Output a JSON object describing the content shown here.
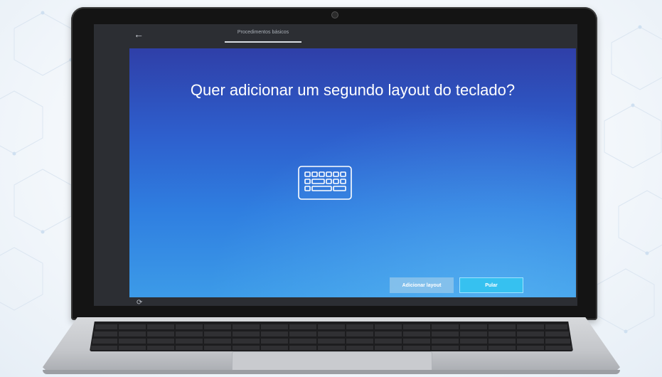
{
  "window": {
    "tab_label": "Procedimentos básicos",
    "back_icon": "back-arrow-icon"
  },
  "main": {
    "question": "Quer adicionar um segundo layout do teclado?",
    "center_icon": "keyboard-icon"
  },
  "buttons": {
    "add_label": "Adicionar layout",
    "skip_label": "Pular"
  },
  "footer": {
    "power_icon": "accessibility-icon"
  },
  "colors": {
    "panel_top": "#2f3fa8",
    "panel_bottom": "#3c9be8",
    "skip_button": "#36c1f0"
  }
}
